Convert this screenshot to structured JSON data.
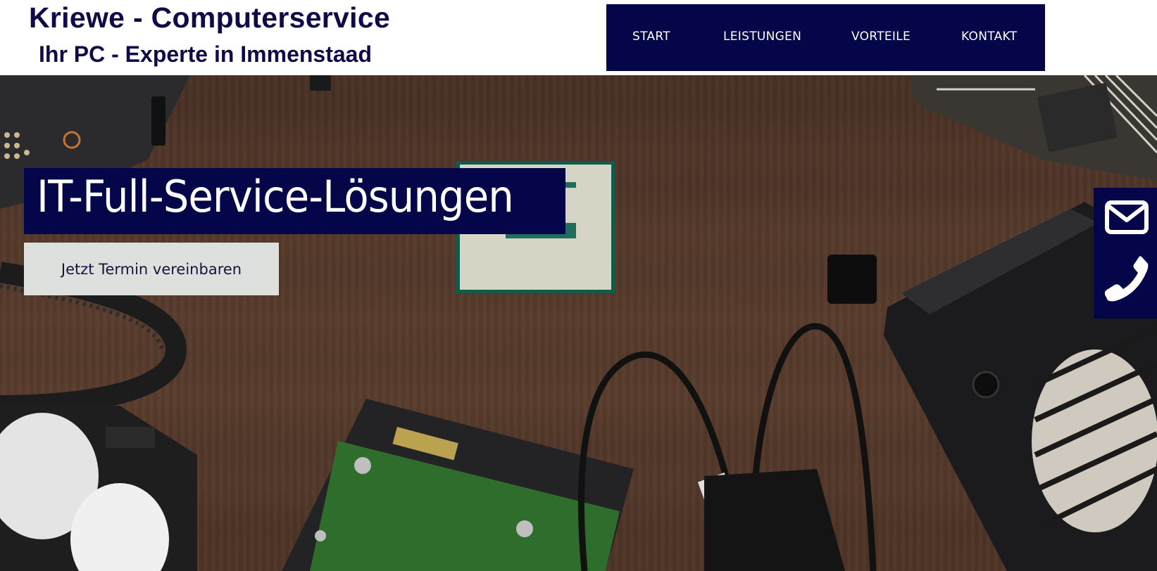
{
  "header": {
    "title": "Kriewe - Computerservice",
    "subtitle": "Ihr PC - Experte in Immenstaad"
  },
  "nav": {
    "items": [
      {
        "label": "START"
      },
      {
        "label": "LEISTUNGEN"
      },
      {
        "label": "VORTEILE"
      },
      {
        "label": "KONTAKT"
      }
    ]
  },
  "hero": {
    "heading": "IT-Full-Service-Lösungen",
    "cta_label": "Jetzt Termin vereinbaren",
    "background_image": "computer-components-on-wooden-desk"
  },
  "contact_tab": {
    "icons": [
      "envelope-icon",
      "phone-icon"
    ]
  },
  "colors": {
    "brand_navy": "#05054a",
    "title_text": "#0e0b47",
    "button_bg": "#dde0dc",
    "white": "#ffffff"
  }
}
